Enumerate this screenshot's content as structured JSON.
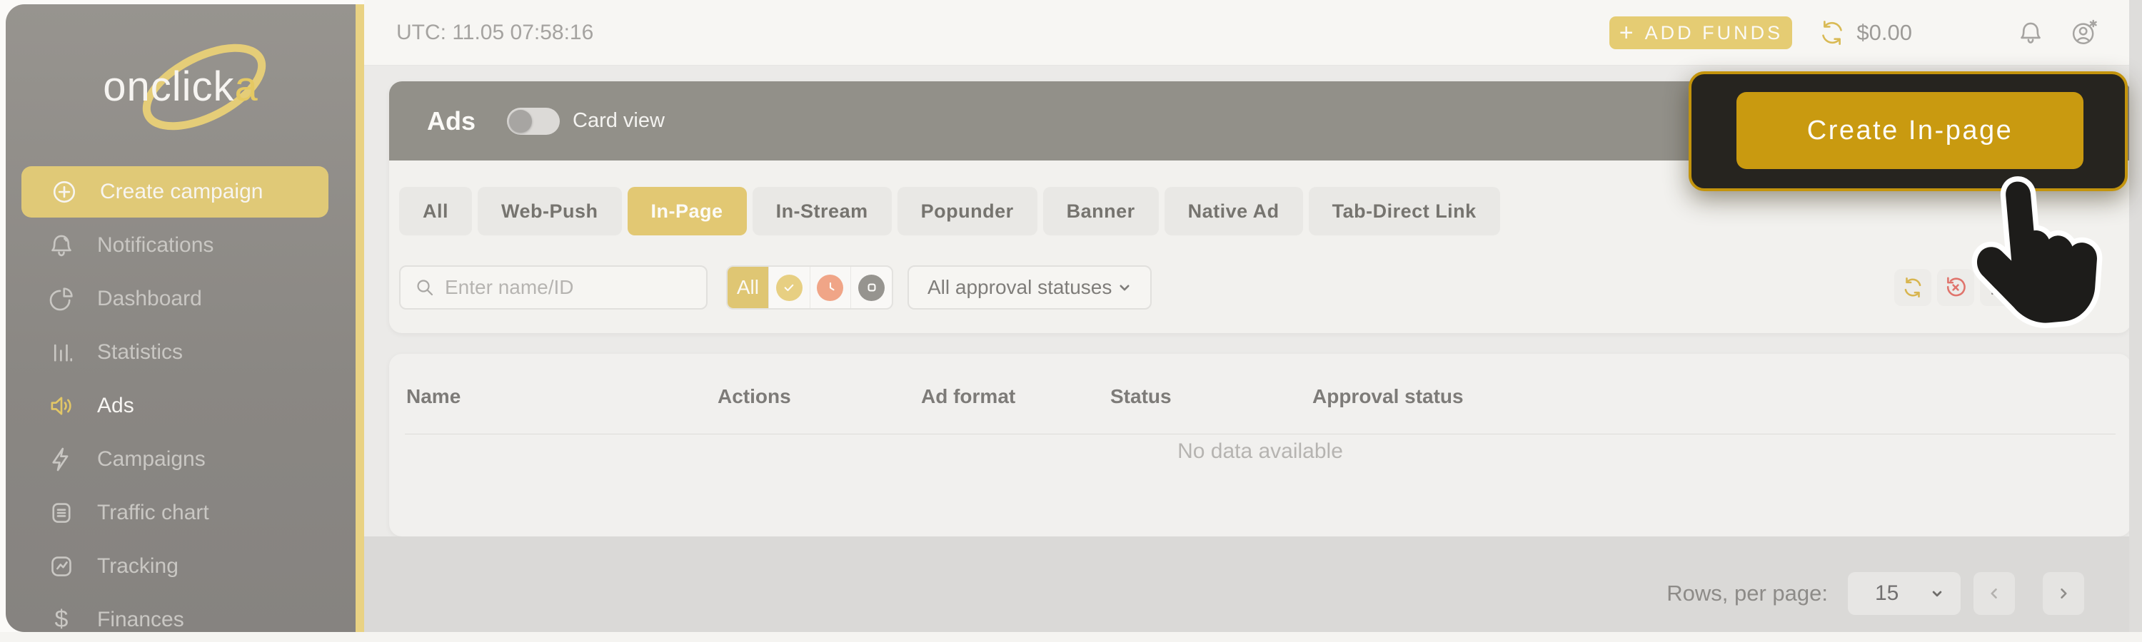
{
  "icons": {
    "plus": "+",
    "dollar": "$"
  },
  "topbar": {
    "utc_label": "UTC: 11.05 07:58:16",
    "add_funds_label": "ADD FUNDS",
    "balance": "$0.00"
  },
  "sidebar": {
    "logo_text": "onclick",
    "logo_accent": "a",
    "create_campaign_label": "Create campaign",
    "items": [
      {
        "label": "Notifications"
      },
      {
        "label": "Dashboard"
      },
      {
        "label": "Statistics"
      },
      {
        "label": "Ads",
        "active": true
      },
      {
        "label": "Campaigns"
      },
      {
        "label": "Traffic chart"
      },
      {
        "label": "Tracking"
      },
      {
        "label": "Finances"
      }
    ]
  },
  "ads_panel": {
    "title": "Ads",
    "card_view_label": "Card view",
    "card_view_on": false
  },
  "tabs": {
    "items": [
      "All",
      "Web-Push",
      "In-Page",
      "In-Stream",
      "Popunder",
      "Banner",
      "Native Ad",
      "Tab-Direct Link"
    ],
    "active": "In-Page"
  },
  "filters": {
    "search_placeholder": "Enter name/ID",
    "status_all_label": "All",
    "approval_value": "All approval statuses"
  },
  "table": {
    "columns": [
      "Name",
      "Actions",
      "Ad format",
      "Status",
      "Approval status"
    ],
    "empty_text": "No data available"
  },
  "pagination": {
    "rows_label": "Rows, per page:",
    "rows_value": "15"
  },
  "highlight": {
    "button_label": "Create In-page"
  },
  "colors": {
    "accent": "#e2c873",
    "accent_strong": "#c99a10",
    "highlight_border": "#c3940d",
    "highlight_bg": "#26241f",
    "pending_salmon": "#f0a587",
    "danger_red": "#e0746c"
  }
}
